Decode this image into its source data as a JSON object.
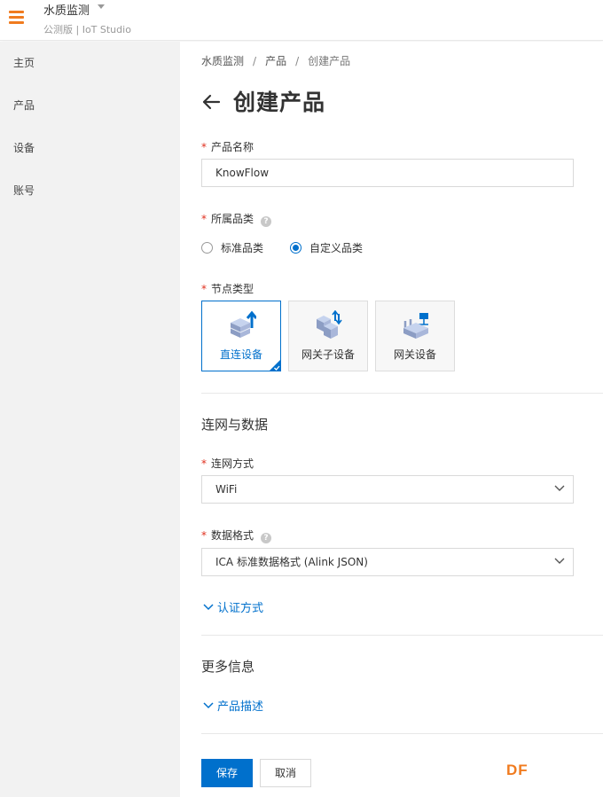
{
  "header": {
    "project_name": "水质监测",
    "subtitle": "公测版 | IoT Studio",
    "accent_color": "#f07b1f"
  },
  "sidebar": {
    "items": [
      {
        "label": "主页"
      },
      {
        "label": "产品"
      },
      {
        "label": "设备"
      },
      {
        "label": "账号"
      }
    ]
  },
  "breadcrumb": {
    "items": [
      "水质监测",
      "产品",
      "创建产品"
    ],
    "separator": "/"
  },
  "page": {
    "title": "创建产品",
    "back_icon": "arrow-left-icon"
  },
  "form": {
    "required_mark": "*",
    "product_name": {
      "label": "产品名称",
      "value": "KnowFlow"
    },
    "category": {
      "label": "所属品类",
      "help_icon": "?",
      "options": [
        "标准品类",
        "自定义品类"
      ],
      "selected": "自定义品类"
    },
    "node_type": {
      "label": "节点类型",
      "options": [
        {
          "label": "直连设备",
          "icon": "direct-device-icon",
          "selected": true
        },
        {
          "label": "网关子设备",
          "icon": "gateway-subdevice-icon",
          "selected": false
        },
        {
          "label": "网关设备",
          "icon": "gateway-device-icon",
          "selected": false
        }
      ]
    },
    "network_section": {
      "title": "连网与数据",
      "connect_method": {
        "label": "连网方式",
        "value": "WiFi"
      },
      "data_format": {
        "label": "数据格式",
        "help_icon": "?",
        "value": "ICA 标准数据格式 (Alink JSON)"
      },
      "auth_toggle": "认证方式"
    },
    "more_section": {
      "title": "更多信息",
      "desc_toggle": "产品描述"
    }
  },
  "actions": {
    "save": "保存",
    "cancel": "取消"
  },
  "watermark": "DF",
  "colors": {
    "primary": "#0070cc",
    "required": "#e0301e",
    "sidebar_bg": "#f2f2f2"
  }
}
